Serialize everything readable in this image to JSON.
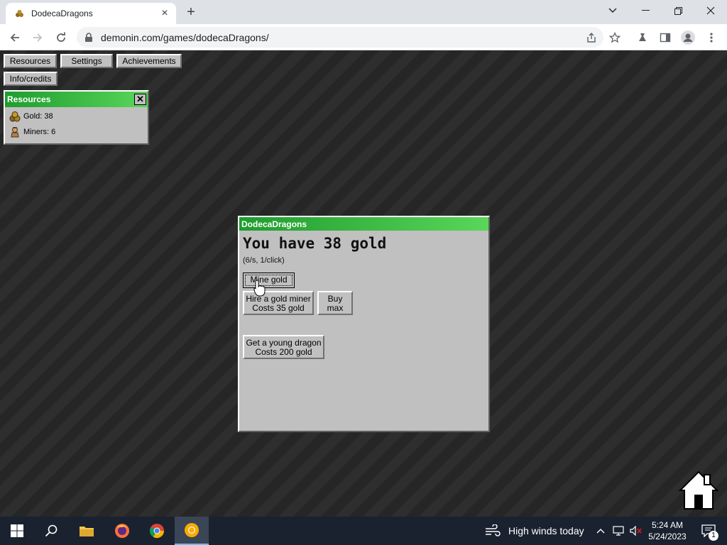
{
  "browser": {
    "tab_title": "DodecaDragons",
    "url": "demonin.com/games/dodecaDragons/"
  },
  "nav_buttons": {
    "resources": "Resources",
    "settings": "Settings",
    "achievements": "Achievements",
    "info": "Info/credits"
  },
  "resources_panel": {
    "title": "Resources",
    "close": "✕",
    "gold": "Gold: 38",
    "miners": "Miners: 6"
  },
  "main_window": {
    "title": "DodecaDragons",
    "heading": "You have 38 gold",
    "rate": "(6/s, 1/click)",
    "mine_gold": "Mine gold",
    "hire_line1": "Hire a gold miner",
    "hire_line2": "Costs 35 gold",
    "buy_line1": "Buy",
    "buy_line2": "max",
    "dragon_line1": "Get a young dragon",
    "dragon_line2": "Costs 200 gold"
  },
  "taskbar": {
    "weather": "High winds today",
    "time": "5:24 AM",
    "date": "5/24/2023",
    "notif_count": "1"
  },
  "colors": {
    "title_green_start": "#1e9c2e",
    "title_green_end": "#5ad65a",
    "panel_gray": "#c0c0c0",
    "page_dark": "#262626"
  },
  "icons": [
    "gold-icon",
    "miner-icon",
    "home-icon",
    "cursor-hand-icon"
  ]
}
